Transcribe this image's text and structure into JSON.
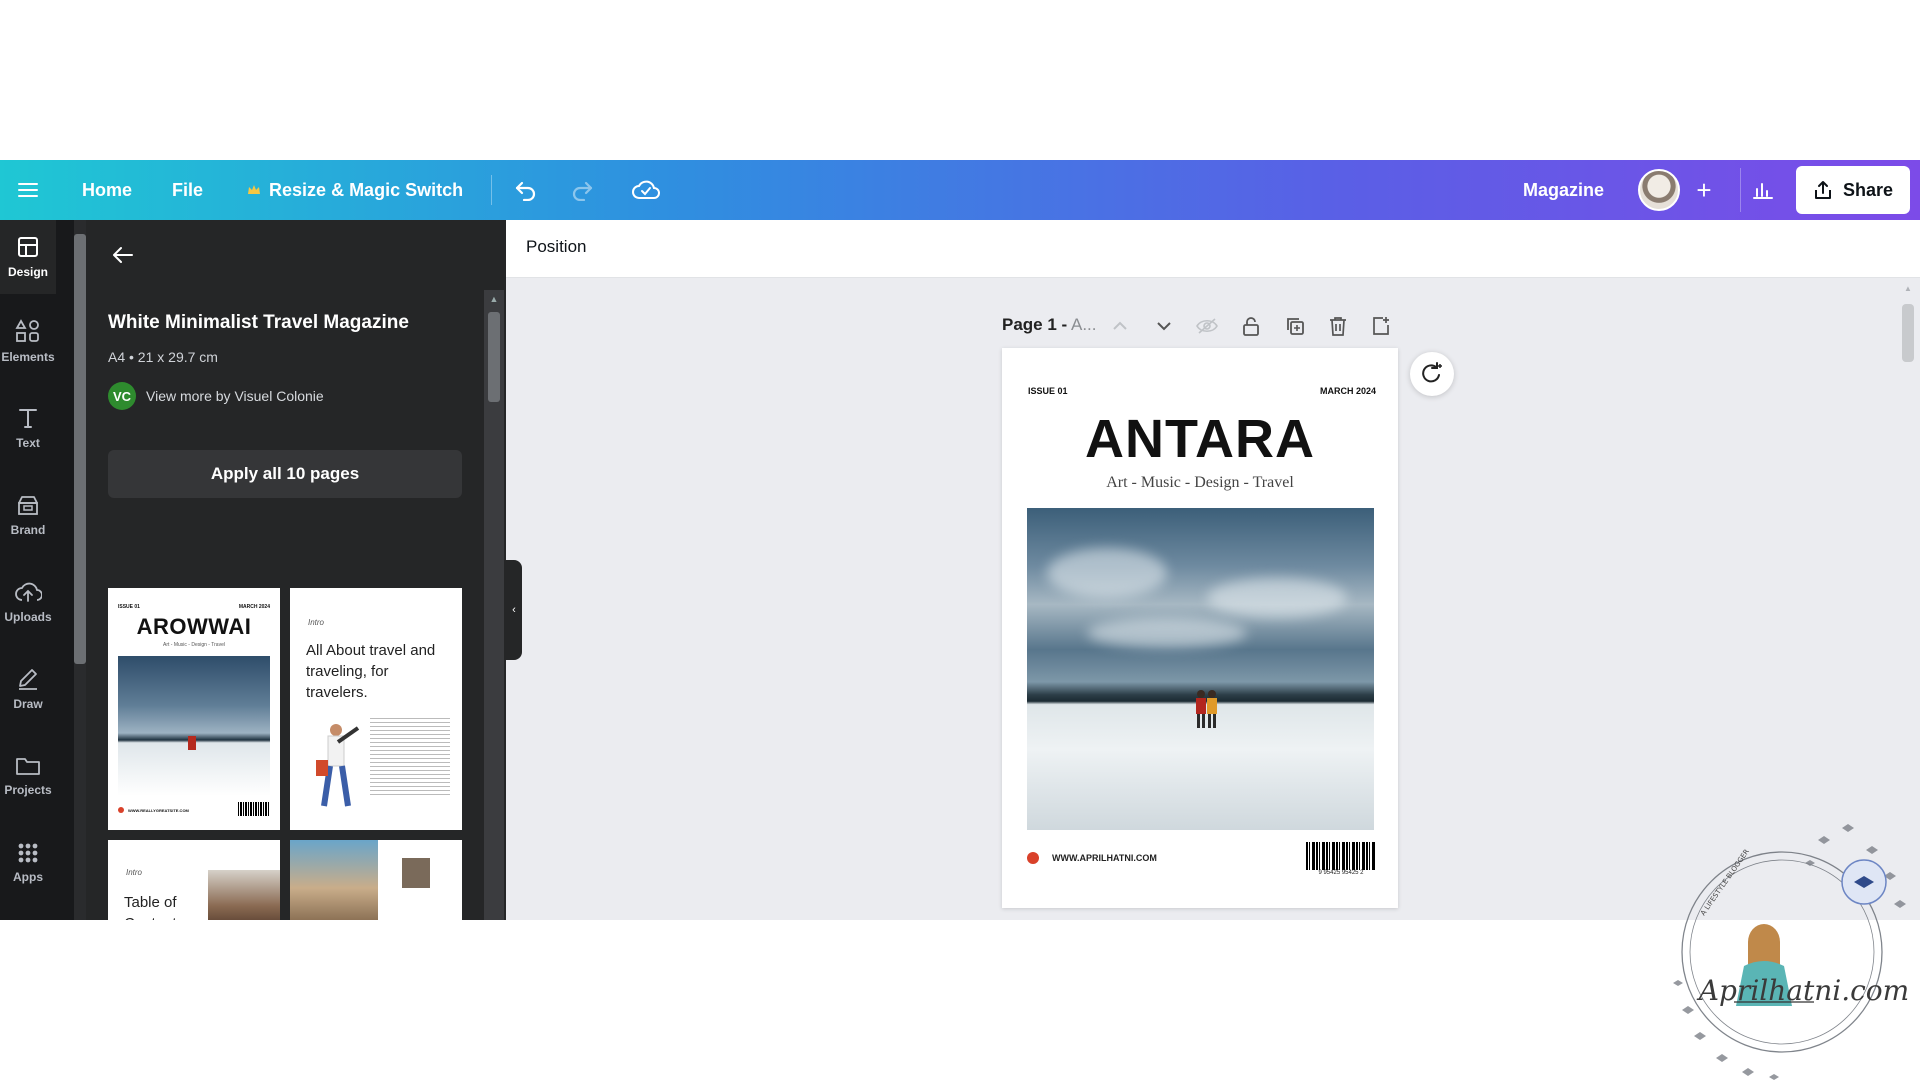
{
  "topbar": {
    "home": "Home",
    "file": "File",
    "resize": "Resize & Magic Switch",
    "title": "Magazine",
    "share": "Share"
  },
  "rail": {
    "items": [
      {
        "label": "Design",
        "icon": "design-icon"
      },
      {
        "label": "Elements",
        "icon": "elements-icon"
      },
      {
        "label": "Text",
        "icon": "text-icon"
      },
      {
        "label": "Brand",
        "icon": "brand-icon"
      },
      {
        "label": "Uploads",
        "icon": "upload-icon"
      },
      {
        "label": "Draw",
        "icon": "draw-icon"
      },
      {
        "label": "Projects",
        "icon": "folder-icon"
      },
      {
        "label": "Apps",
        "icon": "apps-icon"
      }
    ]
  },
  "panel": {
    "title": "White Minimalist Travel Magazine",
    "size": "A4 • 21 x 29.7 cm",
    "author_initials": "VC",
    "author": "View more by Visuel Colonie",
    "apply": "Apply all 10 pages",
    "thumbs": {
      "t1": {
        "issue": "ISSUE 01",
        "date": "MARCH 2024",
        "title": "AROWWAI",
        "subtitle": "Art - Music - Design - Travel",
        "url": "WWW.REALLYGREATSITE.COM"
      },
      "t2": {
        "intro": "Intro",
        "text": "All About travel and traveling, for travelers."
      },
      "t3": {
        "intro": "Intro",
        "text": "Table of Contents"
      }
    }
  },
  "context": {
    "position": "Position"
  },
  "page": {
    "label_bold": "Page 1 -",
    "label_rest": " A..."
  },
  "magazine": {
    "issue": "ISSUE 01",
    "date": "MARCH 2024",
    "title": "ANTARA",
    "subtitle": "Art - Music - Design - Travel",
    "url": "WWW.APRILHATNI.COM",
    "barcode_num": "9 95425 95425 2"
  },
  "watermark": {
    "text": "Aprilhatni.com",
    "tagline": "A LIFESTYLE BLOGGER"
  },
  "colors": {
    "brand_gradient_start": "#1fc7d4",
    "brand_gradient_end": "#7c4be8",
    "panel_bg": "#252627",
    "rail_bg": "#18191b",
    "canvas_bg": "#ebecf0",
    "accent_dot": "#d9412a"
  }
}
